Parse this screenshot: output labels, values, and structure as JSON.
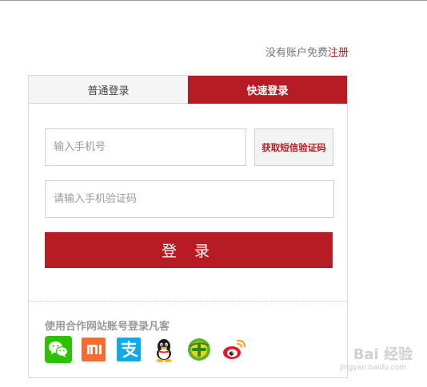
{
  "header": {
    "register_prompt": "没有账户免费",
    "register_link": "注册"
  },
  "tabs": [
    {
      "label": "普通登录",
      "active": false
    },
    {
      "label": "快速登录",
      "active": true
    }
  ],
  "form": {
    "phone_placeholder": "输入手机号",
    "sms_button": "获取短信验证码",
    "code_placeholder": "请输入手机验证码",
    "login_button": "登 录"
  },
  "partner": {
    "title": "使用合作网站账号登录凡客",
    "icons": [
      "wechat-icon",
      "xiaomi-icon",
      "alipay-icon",
      "qq-icon",
      "360-icon",
      "weibo-icon"
    ]
  },
  "colors": {
    "brand_red": "#b71c25",
    "wechat_green": "#2dc100",
    "xiaomi_orange": "#f16d34",
    "alipay_blue": "#12a9e8",
    "qihoo_green": "#5ab52e"
  },
  "watermark": {
    "text": "Bai 经验",
    "sub": "jingyan.baidu.com"
  }
}
